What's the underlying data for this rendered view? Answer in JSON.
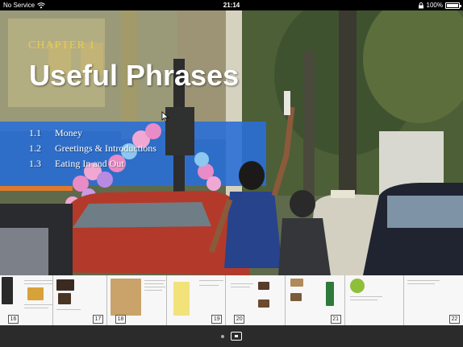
{
  "status_bar": {
    "carrier": "No Service",
    "time": "21:14",
    "battery": "100%"
  },
  "chapter": {
    "label": "CHAPTER 1",
    "title": "Useful Phrases",
    "sections": [
      {
        "num": "1.1",
        "title": "Money"
      },
      {
        "num": "1.2",
        "title": "Greetings & Introductions"
      },
      {
        "num": "1.3",
        "title": "Eating In and Out"
      }
    ]
  },
  "thumbnails": {
    "spreads": [
      {
        "left": "16",
        "right": "17"
      },
      {
        "left": "18",
        "right": "19"
      },
      {
        "left": "20",
        "right": "21"
      },
      {
        "left": "",
        "right": "22"
      }
    ]
  },
  "page_control": {
    "dot_count": 1,
    "current": "current-page"
  },
  "colors": {
    "title_white": "#ffffff",
    "chapter_yellow": "#f2d24a",
    "toc_panel_blue": "#2a6fd6"
  }
}
